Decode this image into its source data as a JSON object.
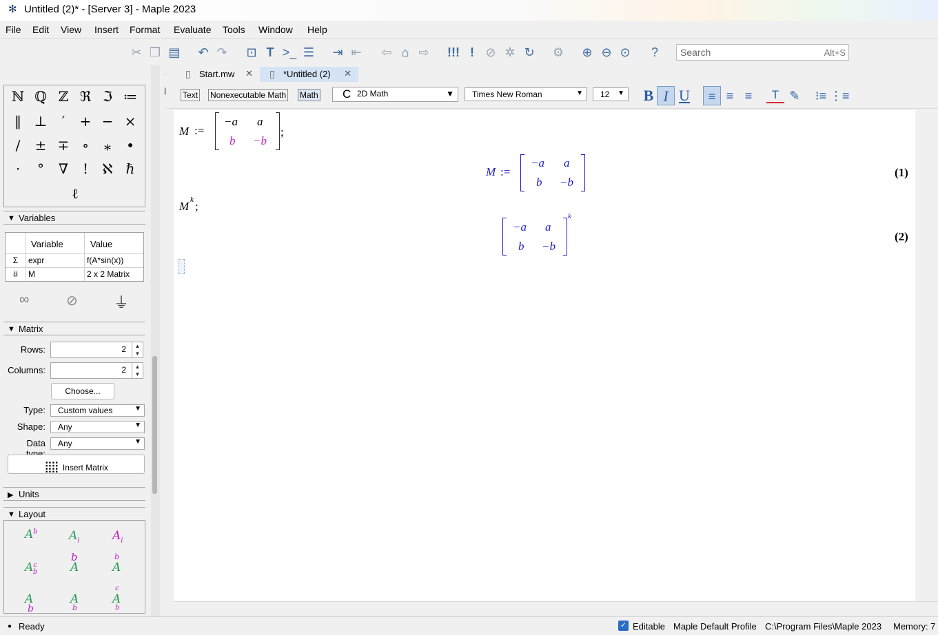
{
  "window": {
    "title": "Untitled (2)* - [Server 3] - Maple 2023"
  },
  "menu": [
    "File",
    "Edit",
    "View",
    "Insert",
    "Format",
    "Evaluate",
    "Tools",
    "Window",
    "Help"
  ],
  "search": {
    "placeholder": "Search",
    "shortcut": "Alt+S"
  },
  "palette": {
    "symbols_row1": [
      "ℕ",
      "ℚ",
      "ℤ",
      "ℜ",
      "ℑ",
      "≔"
    ],
    "symbols_row2": [
      "‖",
      "⊥",
      "′",
      "+",
      "−",
      "×"
    ],
    "symbols_row3": [
      "/",
      "±",
      "∓",
      "∘",
      "⁎",
      "•"
    ],
    "symbols_row4": [
      "·",
      "°",
      "∇",
      "!",
      "ℵ",
      "ℏ"
    ],
    "symbols_row5": [
      "ℓ"
    ]
  },
  "variables": {
    "title": "Variables",
    "col_variable": "Variable",
    "col_value": "Value",
    "rows": [
      {
        "icon": "Σ",
        "name": "expr",
        "value": "f(A*sin(x))"
      },
      {
        "icon": "#",
        "name": "M",
        "value": "2 x 2 Matrix"
      }
    ]
  },
  "matrix_panel": {
    "title": "Matrix",
    "rows_label": "Rows:",
    "rows_value": "2",
    "cols_label": "Columns:",
    "cols_value": "2",
    "choose_label": "Choose...",
    "type_label": "Type:",
    "type_value": "Custom values",
    "shape_label": "Shape:",
    "shape_value": "Any",
    "datatype_label": "Data type:",
    "datatype_value": "Any",
    "insert_label": "Insert Matrix"
  },
  "units_panel": {
    "title": "Units"
  },
  "layout_panel": {
    "title": "Layout"
  },
  "doc_tabs": [
    {
      "label": "Start.mw"
    },
    {
      "label": "*Untitled (2)"
    }
  ],
  "format_bar": {
    "text_mode": "Text",
    "nonexec_mode": "Nonexecutable Math",
    "math_mode": "Math",
    "input_mode": "2D Math",
    "font": "Times New Roman",
    "size": "12"
  },
  "document": {
    "input1_lhs": "M",
    "input1_assign": ":=",
    "input1_m11": "−a",
    "input1_m12": "a",
    "input1_m21": "b",
    "input1_m22": "−b",
    "input1_end": ";",
    "output1_lhs": "M",
    "output1_assign": ":=",
    "output1_m11": "−a",
    "output1_m12": "a",
    "output1_m21": "b",
    "output1_m22": "−b",
    "output1_label": "(1)",
    "input2_base": "M",
    "input2_exp": "k",
    "input2_end": ";",
    "output2_m11": "−a",
    "output2_m12": "a",
    "output2_m21": "b",
    "output2_m22": "−b",
    "output2_exp": "k",
    "output2_label": "(2)"
  },
  "status": {
    "state": "Ready",
    "editable": "Editable",
    "profile": "Maple Default Profile",
    "path": "C:\\Program Files\\Maple 2023",
    "memory": "Memory: 7"
  },
  "colors": {
    "output_blue": "#1c1cc8",
    "input_magenta": "#c020c0",
    "accent": "#2b5ea7"
  }
}
